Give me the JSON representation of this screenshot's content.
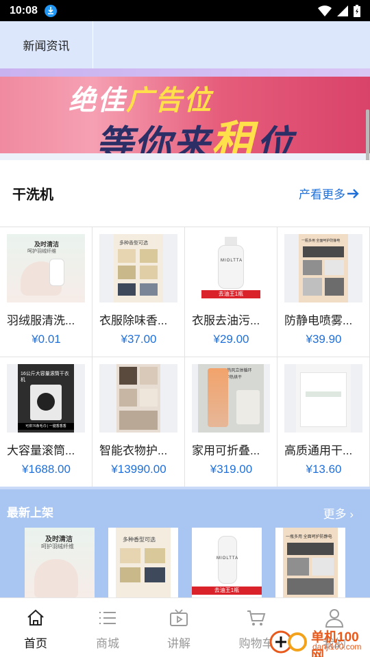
{
  "status_bar": {
    "time": "10:08"
  },
  "tabs": {
    "news_label": "新闻资讯"
  },
  "banner": {
    "line1_a": "绝佳",
    "line1_b": "广告位",
    "line2_a": "等你来",
    "line2_b": "租",
    "line2_c": "位"
  },
  "section": {
    "title": "干洗机",
    "more_label": "产看更多"
  },
  "products": [
    {
      "name": "羽绒服清洗...",
      "price": "¥0.01"
    },
    {
      "name": "衣服除味香...",
      "price": "¥37.00"
    },
    {
      "name": "衣服去油污...",
      "price": "¥29.00"
    },
    {
      "name": "防静电喷雾...",
      "price": "¥39.90"
    },
    {
      "name": "大容量滚筒...",
      "price": "¥1688.00"
    },
    {
      "name": "智能衣物护...",
      "price": "¥13990.00"
    },
    {
      "name": "家用可折叠...",
      "price": "¥319.00"
    },
    {
      "name": "高质通用干...",
      "price": "¥13.60"
    }
  ],
  "thumb_text": {
    "t1_line1": "及时清洁",
    "t1_line2": "呵护羽绒纤维",
    "t2_line1": "多种香型可选",
    "t3_brand": "MIOLTTA",
    "t3_tag": "去油王1瓶",
    "t4_line1": "一瓶多用 全面呵护防静电",
    "t5_line1": "16公斤大容量滚筒干衣机",
    "t5_tag": "可烘76条毛巾 | 一键香香香",
    "t7_line1": "360°热风立体循环",
    "t7_line2": "即热烘干"
  },
  "latest": {
    "title": "最新上架",
    "more_label": "更多"
  },
  "nav": [
    {
      "label": "首页",
      "icon": "home-icon"
    },
    {
      "label": "商城",
      "icon": "list-icon"
    },
    {
      "label": "讲解",
      "icon": "tv-icon"
    },
    {
      "label": "购物车",
      "icon": "cart-icon"
    },
    {
      "label": "我的",
      "icon": "user-icon"
    }
  ],
  "watermark": {
    "text": "单机100网",
    "url": "danji100.com"
  },
  "colors": {
    "accent": "#1e6fd9",
    "tab_bg": "#dce7fb",
    "latest_bg": "#a9c6f3"
  }
}
